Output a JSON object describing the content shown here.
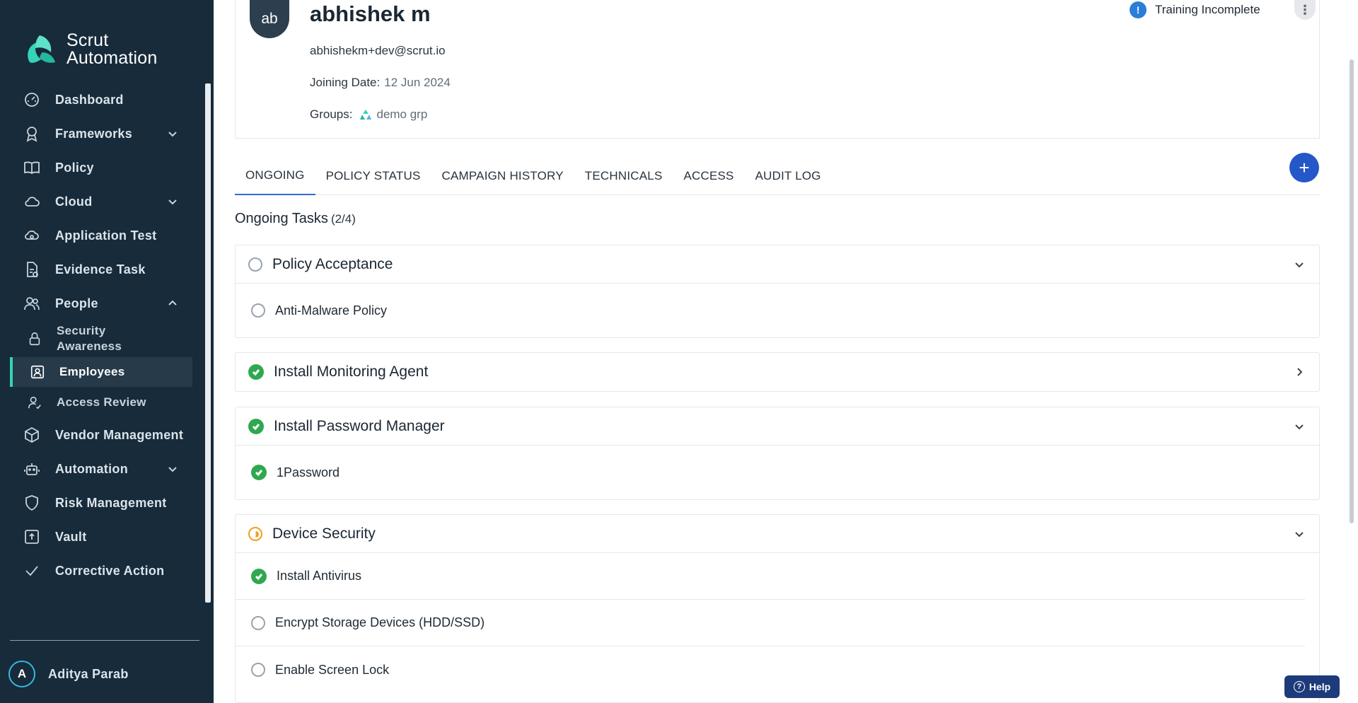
{
  "brand": {
    "name_line1": "Scrut",
    "name_line2": "Automation"
  },
  "sidebar": {
    "items": [
      {
        "label": "Dashboard",
        "icon": "dashboard-icon"
      },
      {
        "label": "Frameworks",
        "icon": "award-icon",
        "expandable": true
      },
      {
        "label": "Policy",
        "icon": "book-icon"
      },
      {
        "label": "Cloud",
        "icon": "cloud-icon",
        "expandable": true
      },
      {
        "label": "Application Test",
        "icon": "cloud-bug-icon"
      },
      {
        "label": "Evidence Task",
        "icon": "file-check-icon"
      },
      {
        "label": "People",
        "icon": "people-icon",
        "expanded": true
      }
    ],
    "people_sub": {
      "security_awareness_1": "Security",
      "security_awareness_2": "Awareness",
      "employees": "Employees",
      "access_review": "Access Review"
    },
    "items_after": [
      {
        "label": "Vendor Management",
        "icon": "box-icon"
      },
      {
        "label": "Automation",
        "icon": "robot-icon",
        "expandable": true
      },
      {
        "label": "Risk Management",
        "icon": "shield-icon"
      },
      {
        "label": "Vault",
        "icon": "vault-icon"
      },
      {
        "label": "Corrective Action",
        "icon": "checkmark-icon"
      }
    ],
    "user": {
      "initial": "A",
      "name": "Aditya Parab"
    }
  },
  "profile": {
    "avatar_initials": "ab",
    "name": "abhishek m",
    "email": "abhishekm+dev@scrut.io",
    "joining_label": "Joining Date:",
    "joining_value": "12 Jun 2024",
    "groups_label": "Groups:",
    "groups_value": "demo grp",
    "training_status": "Training Incomplete"
  },
  "tabs": [
    "ONGOING",
    "POLICY STATUS",
    "CAMPAIGN HISTORY",
    "TECHNICALS",
    "ACCESS",
    "AUDIT LOG"
  ],
  "active_tab": "ONGOING",
  "ongoing": {
    "title": "Ongoing Tasks",
    "count": "(2/4)",
    "groups": [
      {
        "title": "Policy Acceptance",
        "status": "pending",
        "items": [
          {
            "label": "Anti-Malware Policy",
            "status": "pending"
          }
        ]
      },
      {
        "title": "Install Monitoring Agent",
        "status": "done",
        "collapsed": true
      },
      {
        "title": "Install Password Manager",
        "status": "done",
        "items": [
          {
            "label": "1Password",
            "status": "done"
          }
        ]
      },
      {
        "title": "Device Security",
        "status": "in-progress",
        "items": [
          {
            "label": "Install Antivirus",
            "status": "done"
          },
          {
            "label": "Encrypt Storage Devices (HDD/SSD)",
            "status": "pending"
          },
          {
            "label": "Enable Screen Lock",
            "status": "pending"
          }
        ]
      }
    ]
  },
  "help_label": "Help",
  "colors": {
    "sidebar_bg": "#172b3a",
    "accent": "#35d3b8",
    "primary": "#2458c8",
    "success": "#2fa84f",
    "warning": "#f0a020",
    "info": "#2a7ed8"
  }
}
